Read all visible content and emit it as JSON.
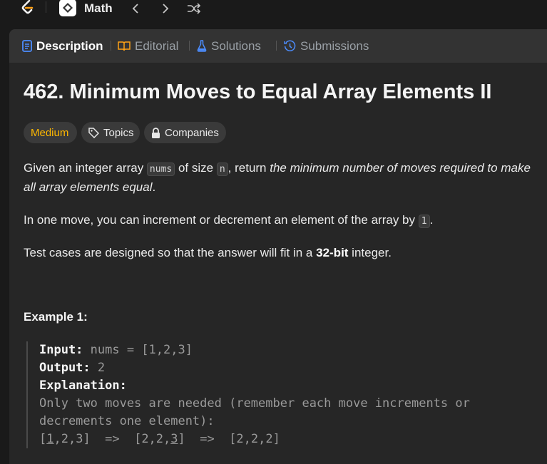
{
  "topbar": {
    "problem_list_label": "Math"
  },
  "tabs": [
    {
      "label": "Description"
    },
    {
      "label": "Editorial"
    },
    {
      "label": "Solutions"
    },
    {
      "label": "Submissions"
    }
  ],
  "problem": {
    "title": "462. Minimum Moves to Equal Array Elements II",
    "difficulty": "Medium",
    "topics_label": "Topics",
    "companies_label": "Companies",
    "p1_a": "Given an integer array ",
    "p1_code1": "nums",
    "p1_b": " of size ",
    "p1_code2": "n",
    "p1_c": ", return ",
    "p1_em": "the minimum number of moves required to make all array elements equal",
    "p1_d": ".",
    "p2_a": "In one move, you can increment or decrement an element of the array by ",
    "p2_code": "1",
    "p2_b": ".",
    "p3_a": "Test cases are designed so that the answer will fit in a ",
    "p3_strong": "32-bit",
    "p3_b": " integer."
  },
  "example": {
    "title": "Example 1:",
    "input_label": "Input:",
    "input_value": " nums = [1,2,3]",
    "output_label": "Output:",
    "output_value": " 2",
    "explanation_label": "Explanation:",
    "explanation_line1": "Only two moves are needed (remember each move increments or",
    "explanation_line2": "decrements one element):",
    "seq_1a": "[",
    "seq_1u": "1",
    "seq_1b": ",2,3]  =>  [2,2,",
    "seq_2u": "3",
    "seq_2b": "]  =>  [2,2,2]"
  },
  "colors": {
    "difficulty_medium": "#ffb800",
    "accent_description": "#4c8dff"
  }
}
